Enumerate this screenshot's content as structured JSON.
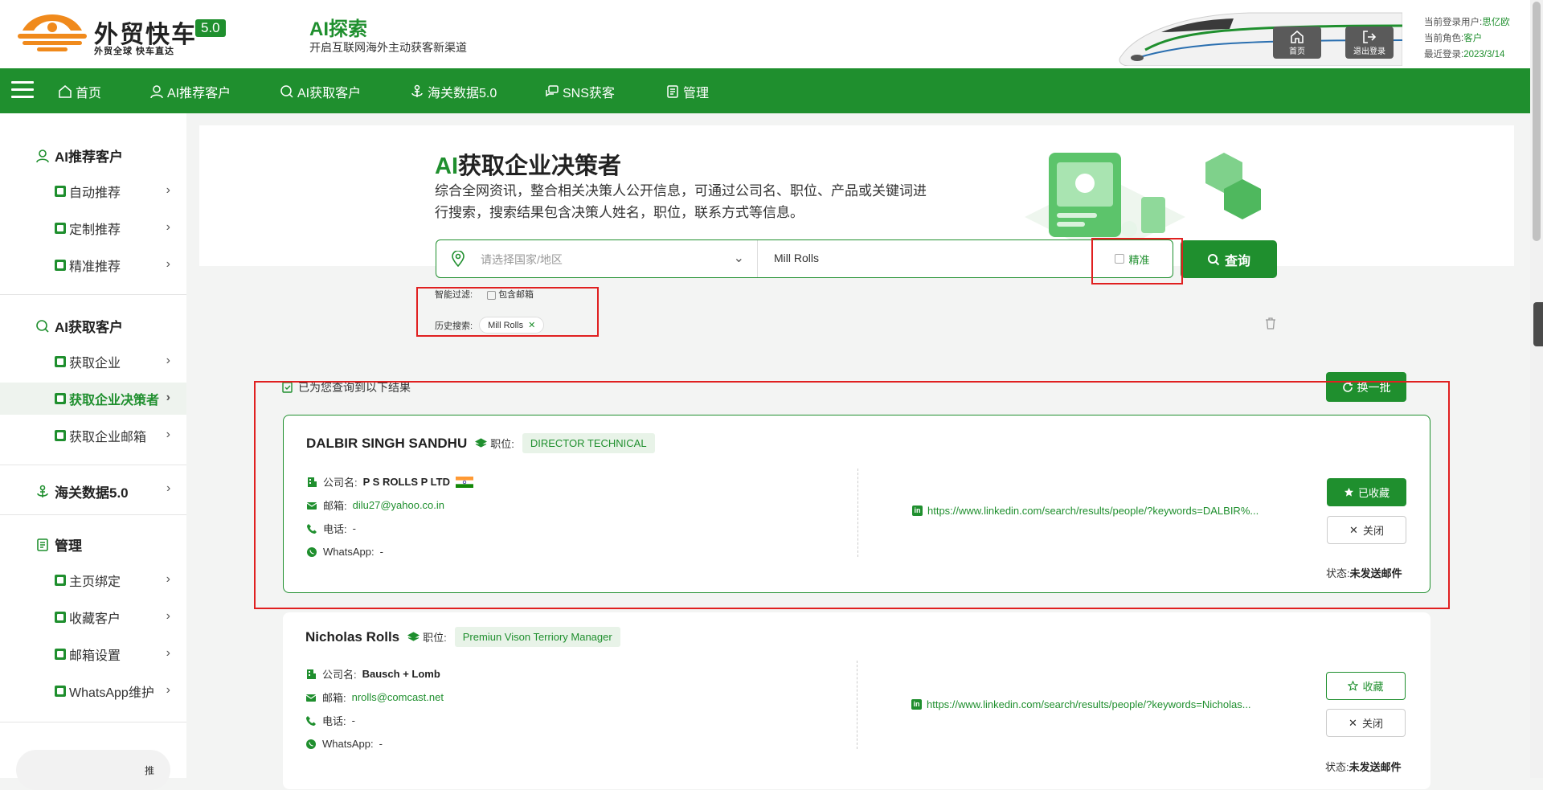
{
  "header": {
    "logo_text": "外贸快车",
    "version": "5.0",
    "slogan": "外贸全球 快车直达",
    "section_title": "AI探索",
    "section_subtitle": "开启互联网海外主动获客新渠道",
    "home_label": "首页",
    "logout_label": "退出登录",
    "user_label": "当前登录用户:",
    "user_value": "思亿欧",
    "role_label": "当前角色:",
    "role_value": "客户",
    "last_login_label": "最近登录:",
    "last_login_value": "2023/3/14"
  },
  "nav": {
    "items": [
      "首页",
      "AI推荐客户",
      "AI获取客户",
      "海关数据5.0",
      "SNS获客",
      "管理"
    ]
  },
  "sidebar": {
    "group1": "AI推荐客户",
    "group1_items": [
      "自动推荐",
      "定制推荐",
      "精准推荐"
    ],
    "group2": "AI获取客户",
    "group2_items": [
      "获取企业",
      "获取企业决策者",
      "获取企业邮箱"
    ],
    "group3": "海关数据5.0",
    "group4": "管理",
    "group4_items": [
      "主页绑定",
      "收藏客户",
      "邮箱设置",
      "WhatsApp维护"
    ],
    "bottom_text": "推"
  },
  "hero": {
    "title_ai": "AI",
    "title_rest": "获取企业决策者",
    "desc": "综合全网资讯，整合相关决策人公开信息，可通过公司名、职位、产品或关键词进行搜索，搜索结果包含决策人姓名，职位，联系方式等信息。"
  },
  "search": {
    "country_placeholder": "请选择国家/地区",
    "keyword": "Mill Rolls",
    "precise_label": "精准",
    "query_label": "查询",
    "filter_label": "智能过滤:",
    "filter_option": "包含邮箱",
    "history_label": "历史搜索:",
    "history_tag": "Mill Rolls"
  },
  "results": {
    "header": "已为您查询到以下结果",
    "refresh_label": "换一批",
    "position_label": "职位:",
    "company_label": "公司名:",
    "email_label": "邮箱:",
    "phone_label": "电话:",
    "whatsapp_label": "WhatsApp:",
    "status_label": "状态:",
    "close_label": "关闭",
    "items": [
      {
        "name": "DALBIR SINGH SANDHU",
        "position": "DIRECTOR TECHNICAL",
        "company": "P S ROLLS P LTD",
        "email": "dilu27@yahoo.co.in",
        "phone": "-",
        "whatsapp": "-",
        "linkedin": "https://www.linkedin.com/search/results/people/?keywords=DALBIR%...",
        "fav_label": "已收藏",
        "status": "未发送邮件"
      },
      {
        "name": "Nicholas Rolls",
        "position": "Premiun Vison Terriory Manager",
        "company": "Bausch + Lomb",
        "email": "nrolls@comcast.net",
        "phone": "-",
        "whatsapp": "-",
        "linkedin": "https://www.linkedin.com/search/results/people/?keywords=Nicholas...",
        "fav_label": "收藏",
        "status": "未发送邮件"
      }
    ]
  },
  "colors": {
    "brand": "#1f8f2e",
    "highlight": "#e02020"
  }
}
